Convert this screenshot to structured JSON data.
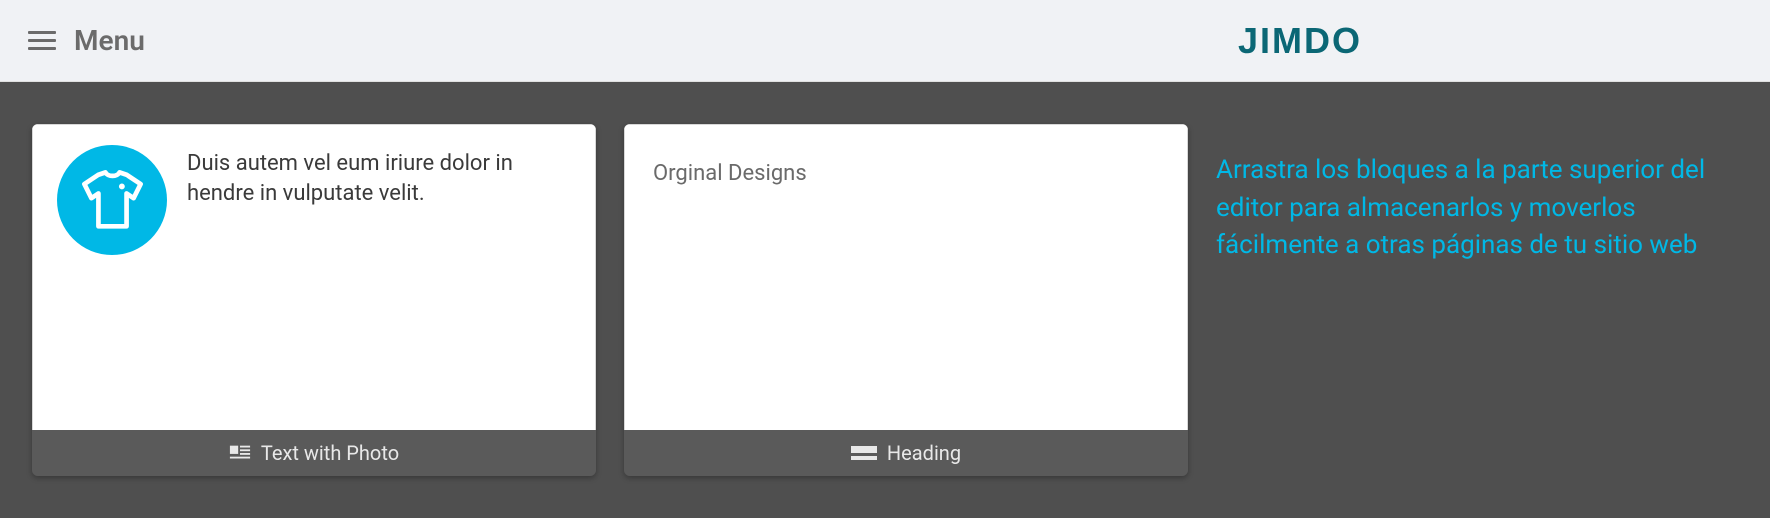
{
  "header": {
    "menu_label": "Menu",
    "logo_text": "JIMDO"
  },
  "blocks": [
    {
      "body_text": "Duis autem vel eum iriure dolor in hendre in vulputate velit.",
      "footer_label": "Text with Photo"
    },
    {
      "body_text": "Orginal Designs",
      "footer_label": "Heading"
    }
  ],
  "instruction_text": "Arrastra los bloques a la parte superior del editor para almacenarlos y moverlos fácilmente a otras páginas de tu sitio web"
}
